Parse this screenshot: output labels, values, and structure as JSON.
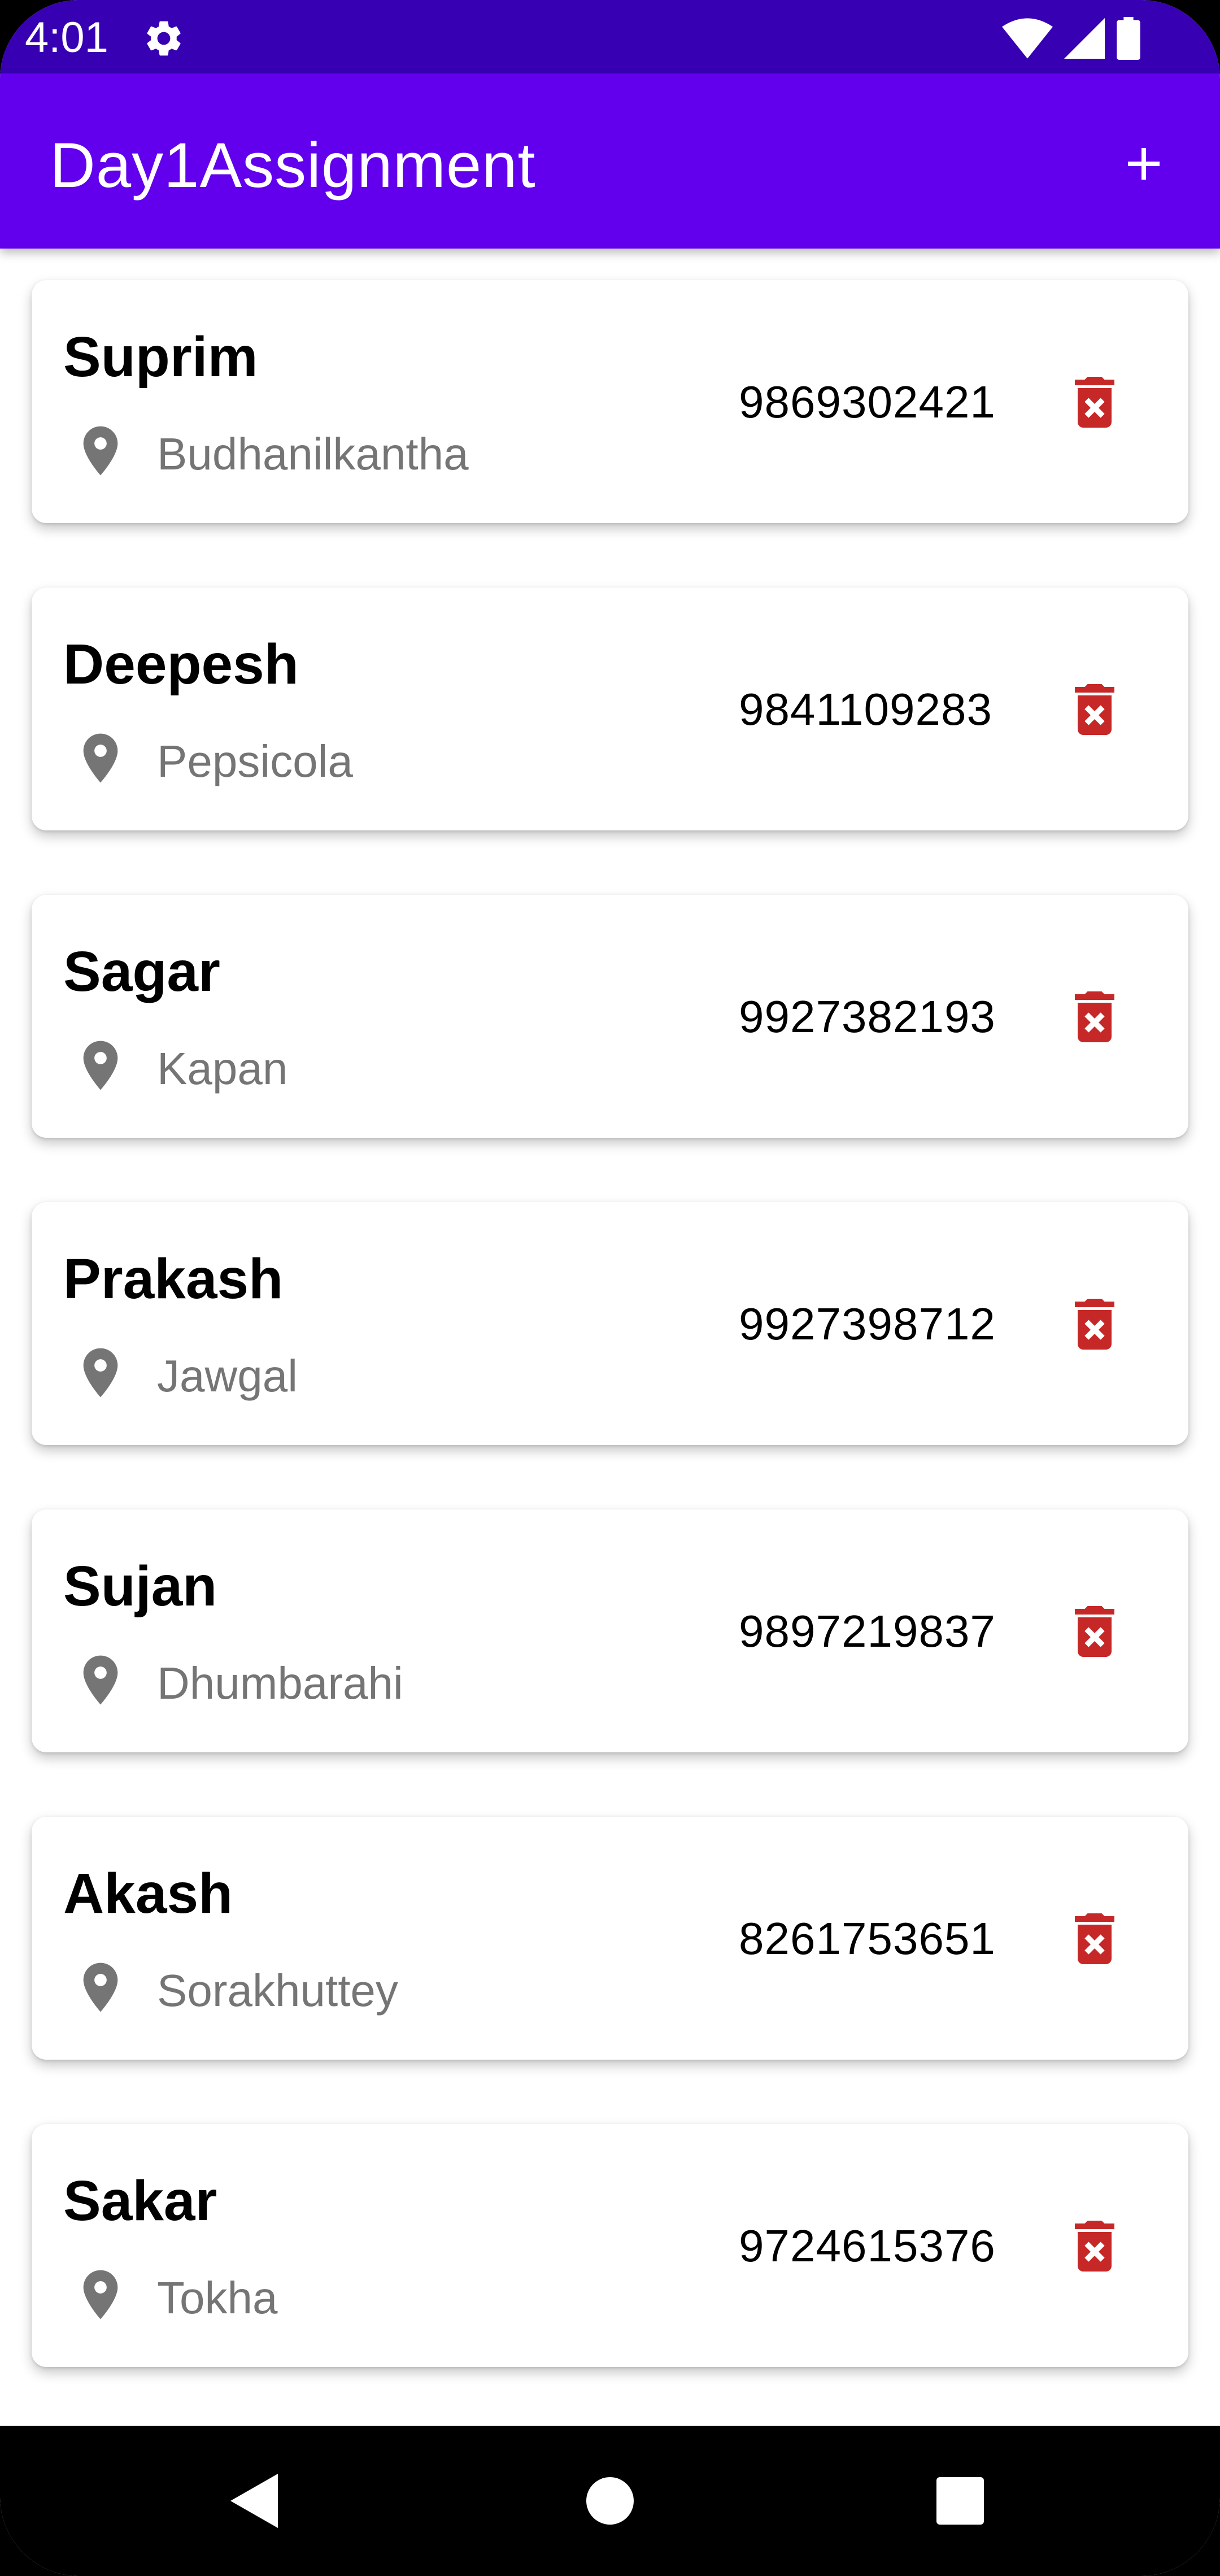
{
  "status_bar": {
    "time": "4:01",
    "icons": [
      "settings-gear-icon",
      "wifi-icon",
      "cell-signal-icon",
      "battery-icon"
    ]
  },
  "app_bar": {
    "title": "Day1Assignment",
    "add_icon": "plus-icon"
  },
  "contacts": [
    {
      "name": "Suprim",
      "location": "Budhanilkantha",
      "phone": "9869302421"
    },
    {
      "name": "Deepesh",
      "location": "Pepsicola",
      "phone": "9841109283"
    },
    {
      "name": "Sagar",
      "location": "Kapan",
      "phone": "9927382193"
    },
    {
      "name": "Prakash",
      "location": "Jawgal",
      "phone": "9927398712"
    },
    {
      "name": "Sujan",
      "location": "Dhumbarahi",
      "phone": "9897219837"
    },
    {
      "name": "Akash",
      "location": "Sorakhuttey",
      "phone": "8261753651"
    },
    {
      "name": "Sakar",
      "location": "Tokha",
      "phone": "9724615376"
    }
  ],
  "colors": {
    "status_bar": "#3700b3",
    "app_bar": "#6200ee",
    "delete_icon": "#c62828",
    "location_text": "#757575",
    "pin_icon": "#757575"
  },
  "nav_bar": {
    "buttons": [
      "back-icon",
      "home-icon",
      "recents-icon"
    ]
  }
}
